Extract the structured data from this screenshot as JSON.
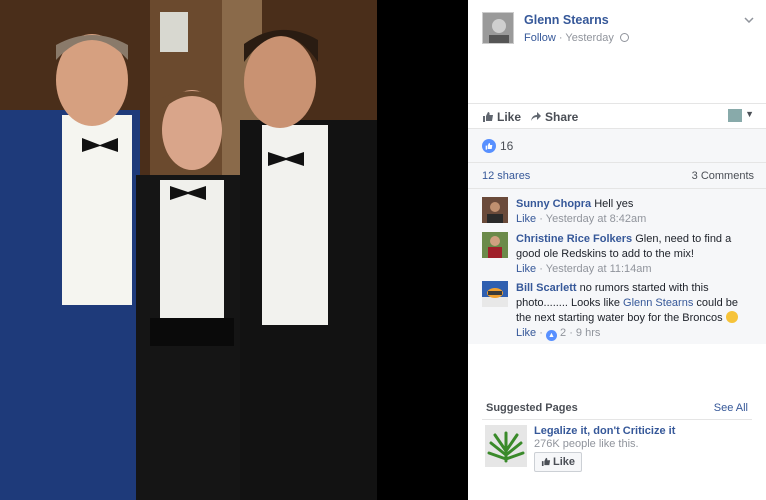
{
  "post": {
    "author": "Glenn Stearns",
    "follow": "Follow",
    "dot": " · ",
    "time": "Yesterday",
    "globe": "·",
    "chevron": "⌄"
  },
  "actions": {
    "like": "Like",
    "share": "Share",
    "like_icon": "thumbs-up-icon",
    "share_icon": "share-arrow-icon"
  },
  "reactions": {
    "count": "16",
    "icon_glyph": "👍"
  },
  "stats": {
    "shares": "12 shares",
    "comments": "3 Comments"
  },
  "comments": [
    {
      "name": "Sunny Chopra",
      "text": " Hell yes",
      "like": "Like",
      "time": " · Yesterday at 8:42am"
    },
    {
      "name": "Christine Rice Folkers",
      "text": " Glen, need to find a good ole Redskins to add to the mix!",
      "like": "Like",
      "time": " · Yesterday at 11:14am"
    },
    {
      "name": "Bill Scarlett",
      "text_before": " no rumors started with this photo........ Looks like ",
      "mention": "Glenn Stearns",
      "text_after": " could be the next starting water boy for the Broncos ",
      "like": "Like",
      "reaction_count": "2",
      "time": " · 9 hrs"
    }
  ],
  "suggested": {
    "title": "Suggested Pages",
    "see_all": "See All",
    "page_name": "Legalize it, don't Criticize it",
    "page_likes": "276K people like this.",
    "like_button": "Like"
  }
}
